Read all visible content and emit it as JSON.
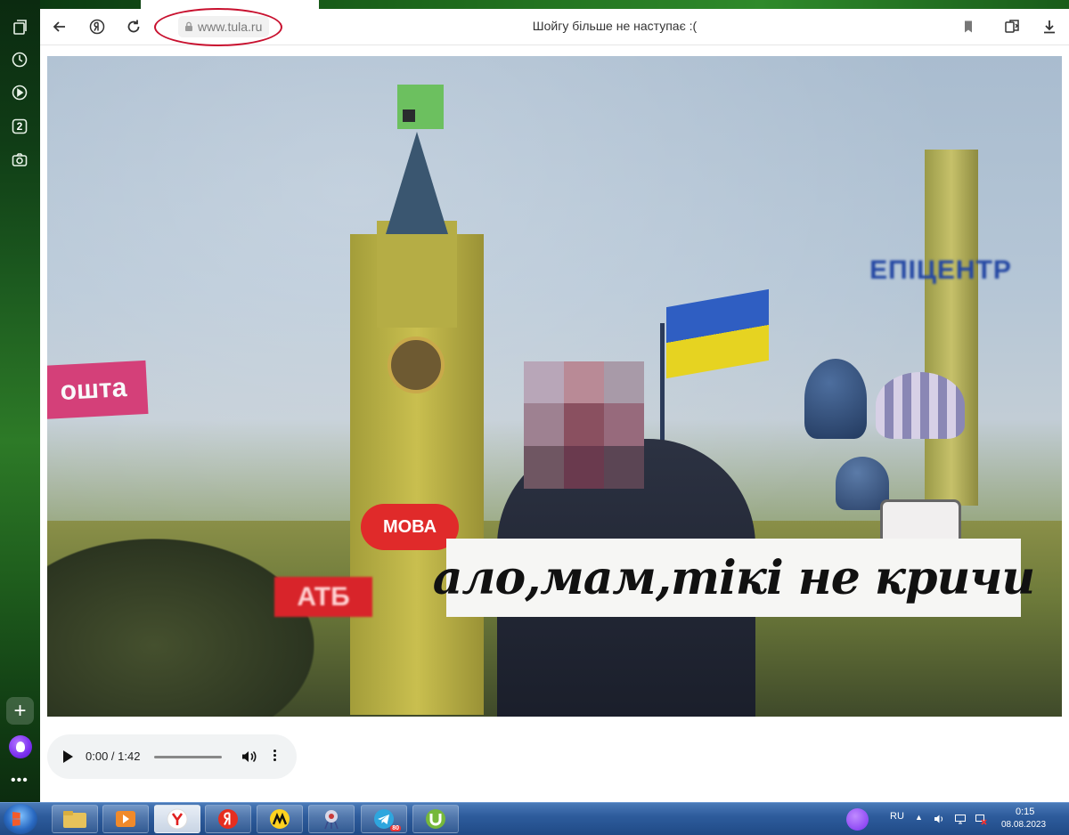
{
  "browser": {
    "url": "www.tula.ru",
    "page_title": "Шойгу більше не наступає :("
  },
  "sidebar": {
    "items": [
      {
        "icon": "collections-icon"
      },
      {
        "icon": "history-icon"
      },
      {
        "icon": "video-icon"
      },
      {
        "icon": "tab-counter-icon",
        "label": "2"
      },
      {
        "icon": "screenshot-icon"
      }
    ]
  },
  "video": {
    "caption": "ало,мам,тікі не кричи",
    "sign_left": "ошта",
    "sign_red": "МОВА",
    "sign_red2": "ATБ",
    "sign_right": "ЕПІЦЕНТР"
  },
  "audio": {
    "time": "0:00 / 1:42",
    "progress": 0
  },
  "taskbar": {
    "language": "RU",
    "time": "0:15",
    "date": "08.08.2023",
    "telegram_badge": "80"
  },
  "colors": {
    "annotation_red": "#c8102e",
    "sidebar_green": "#1c5a1f",
    "taskbar_blue": "#2e5c9c"
  }
}
